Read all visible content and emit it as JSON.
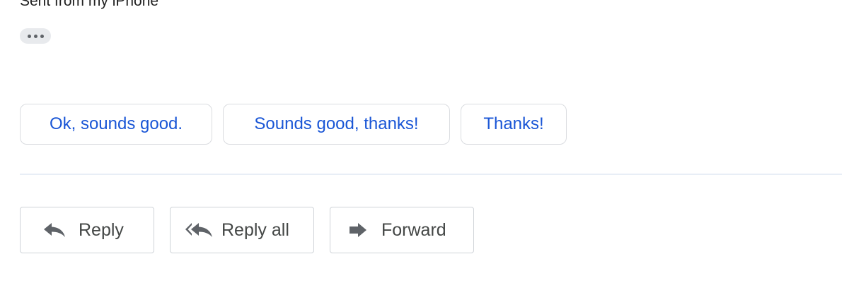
{
  "message": {
    "signature": "Sent from my iPhone",
    "show_trimmed_icon": "more-horiz-icon"
  },
  "smart_replies": [
    {
      "label": "Ok, sounds good."
    },
    {
      "label": "Sounds good, thanks!"
    },
    {
      "label": "Thanks!"
    }
  ],
  "actions": {
    "reply": {
      "label": "Reply",
      "icon": "reply-icon"
    },
    "reply_all": {
      "label": "Reply all",
      "icon": "reply-all-icon"
    },
    "forward": {
      "label": "Forward",
      "icon": "forward-icon"
    }
  },
  "colors": {
    "chip_text": "#1a56d6",
    "chip_border": "#dadce0",
    "action_text": "#444746",
    "icon": "#5f6368",
    "divider": "#e8eef6"
  }
}
